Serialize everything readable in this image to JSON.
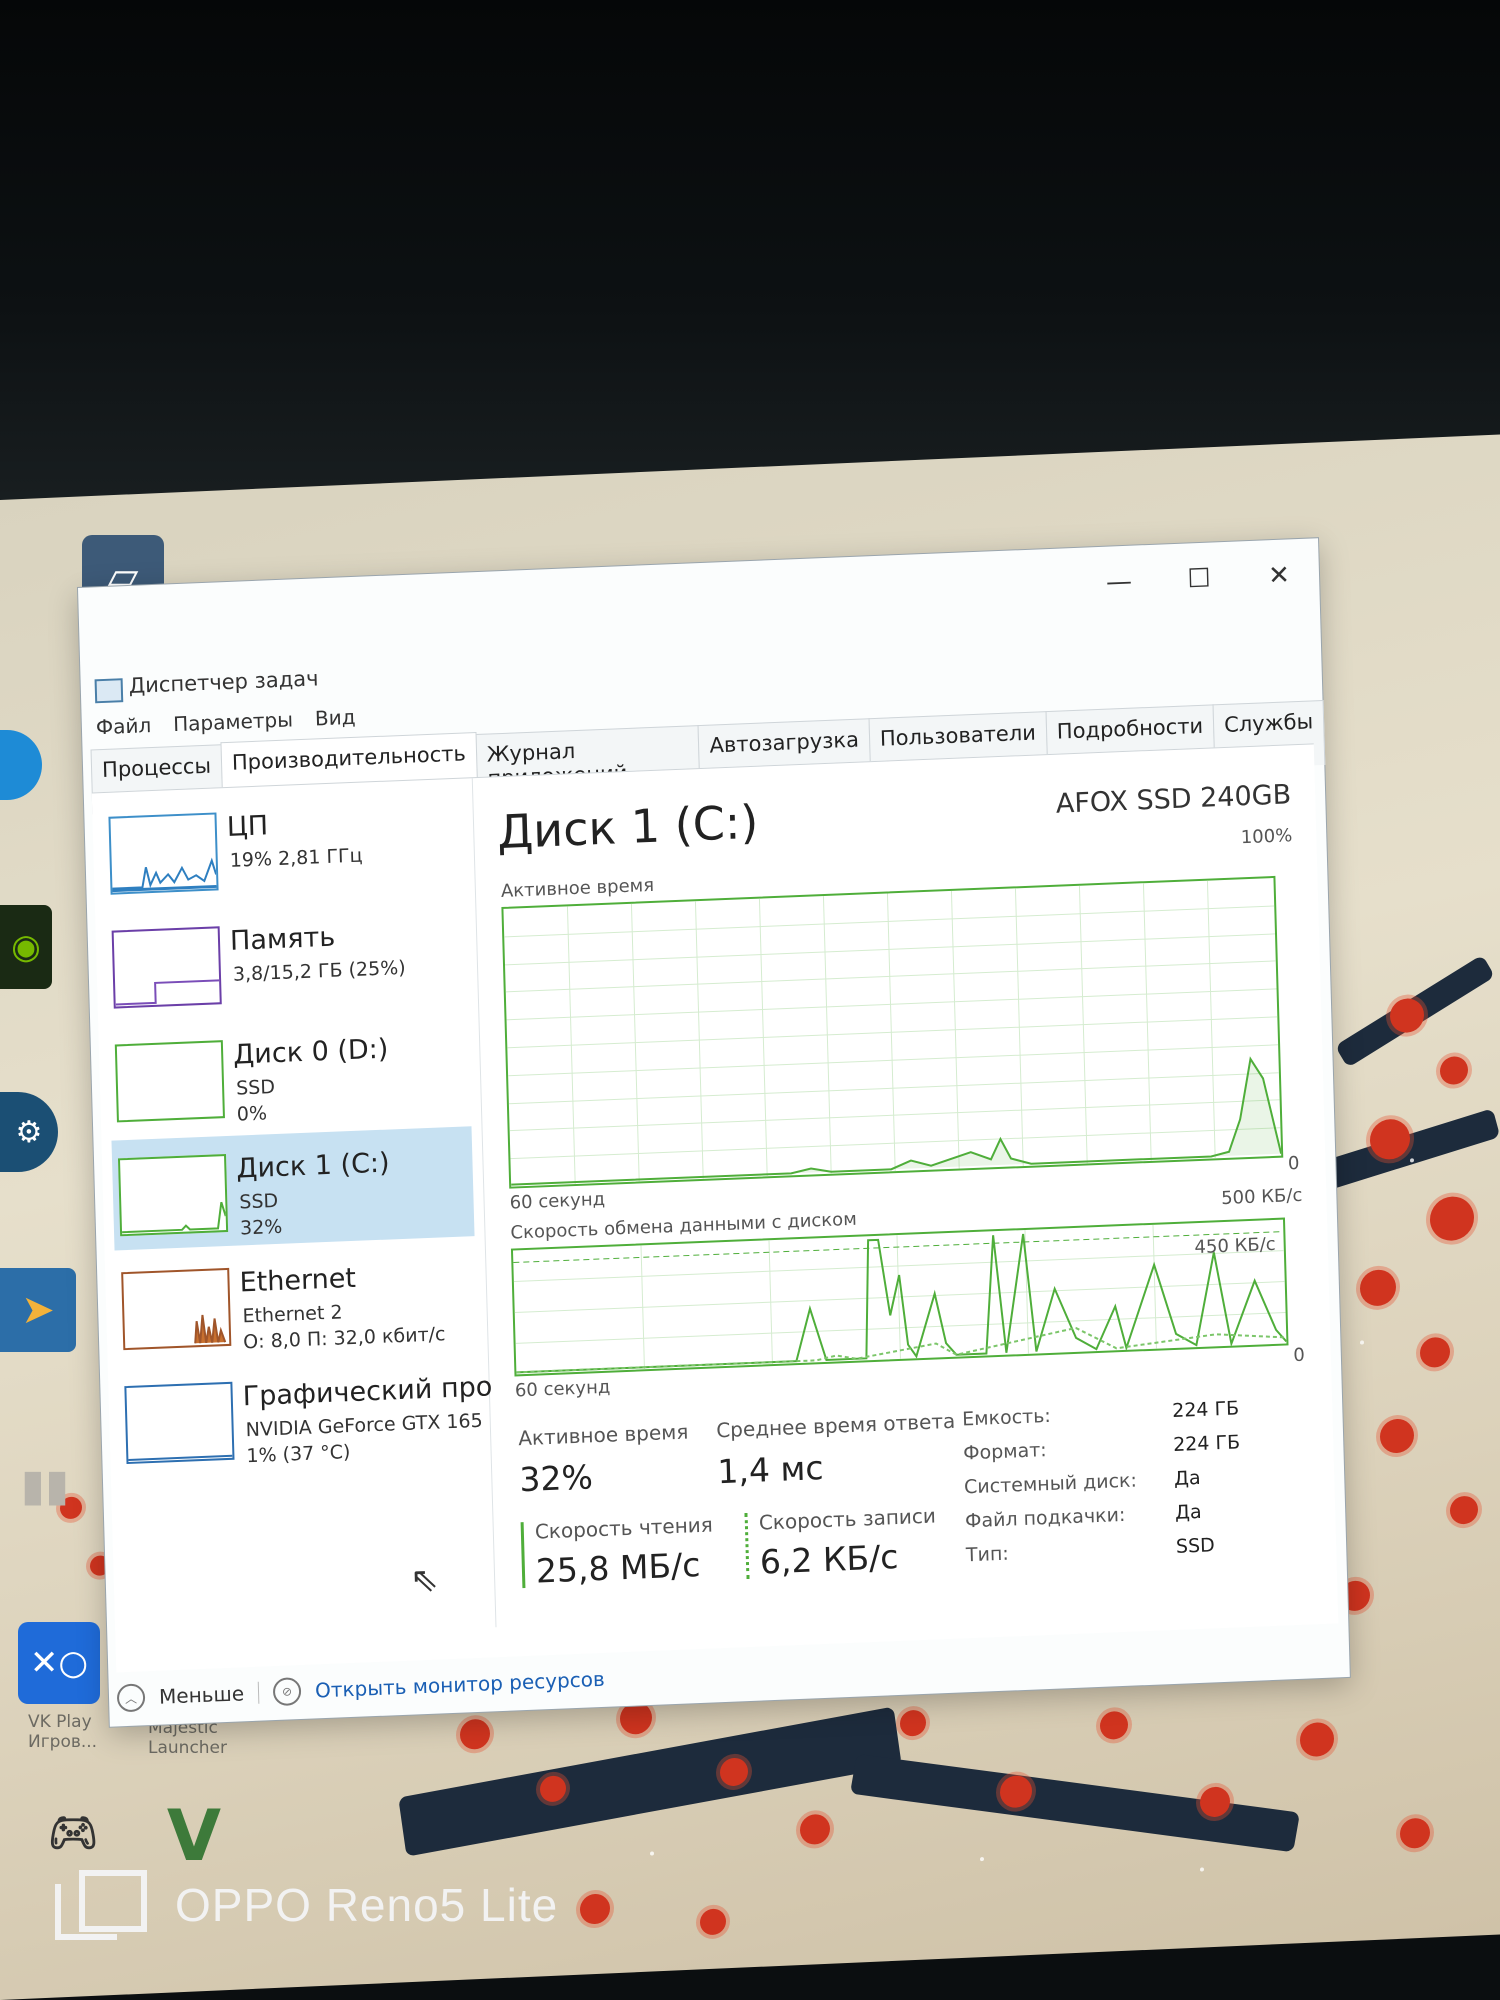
{
  "window": {
    "title": "Диспетчер задач",
    "controls": {
      "minimize": "—",
      "maximize": "☐",
      "close": "✕"
    }
  },
  "menu": [
    "Файл",
    "Параметры",
    "Вид"
  ],
  "tabs": [
    "Процессы",
    "Производительность",
    "Журнал приложений",
    "Автозагрузка",
    "Пользователи",
    "Подробности",
    "Службы"
  ],
  "active_tab_index": 1,
  "sidebar": {
    "items": [
      {
        "title": "ЦП",
        "line1": "19% 2,81 ГГц",
        "line2": ""
      },
      {
        "title": "Память",
        "line1": "3,8/15,2 ГБ (25%)",
        "line2": ""
      },
      {
        "title": "Диск 0 (D:)",
        "line1": "SSD",
        "line2": "0%"
      },
      {
        "title": "Диск 1 (C:)",
        "line1": "SSD",
        "line2": "32%"
      },
      {
        "title": "Ethernet",
        "line1": "Ethernet 2",
        "line2": "О: 8,0 П: 32,0 кбит/с"
      },
      {
        "title": "Графический про",
        "line1": "NVIDIA GeForce GTX 165",
        "line2": "1% (37 °C)"
      }
    ],
    "selected_index": 3
  },
  "detail": {
    "title": "Диск 1 (C:)",
    "model": "AFOX SSD 240GB",
    "graph1": {
      "label": "Активное время",
      "max": "100%",
      "time": "60 секунд",
      "min": "0"
    },
    "graph2": {
      "label": "Скорость обмена данными с диском",
      "max": "500 КБ/с",
      "mid": "450 КБ/с",
      "time": "60 секунд",
      "min": "0"
    },
    "stats": {
      "active_time_label": "Активное время",
      "active_time": "32%",
      "avg_response_label": "Среднее время ответа",
      "avg_response": "1,4 мс",
      "read_label": "Скорость чтения",
      "read": "25,8 МБ/с",
      "write_label": "Скорость записи",
      "write": "6,2 КБ/с"
    },
    "props": [
      {
        "k": "Емкость:",
        "v": "224 ГБ"
      },
      {
        "k": "Формат:",
        "v": "224 ГБ"
      },
      {
        "k": "Системный диск:",
        "v": "Да"
      },
      {
        "k": "Файл подкачки:",
        "v": "Да"
      },
      {
        "k": "Тип:",
        "v": "SSD"
      }
    ]
  },
  "footer": {
    "less": "Меньше",
    "resource_monitor": "Открыть монитор ресурсов"
  },
  "desktop_icons": [
    {
      "label": "VK Play Игров..."
    },
    {
      "label": "Majestic Launcher"
    }
  ],
  "watermark": "OPPO Reno5 Lite",
  "colors": {
    "accent_green": "#4fae3a",
    "selection": "#c7e1f2",
    "link": "#1a5fb4"
  }
}
